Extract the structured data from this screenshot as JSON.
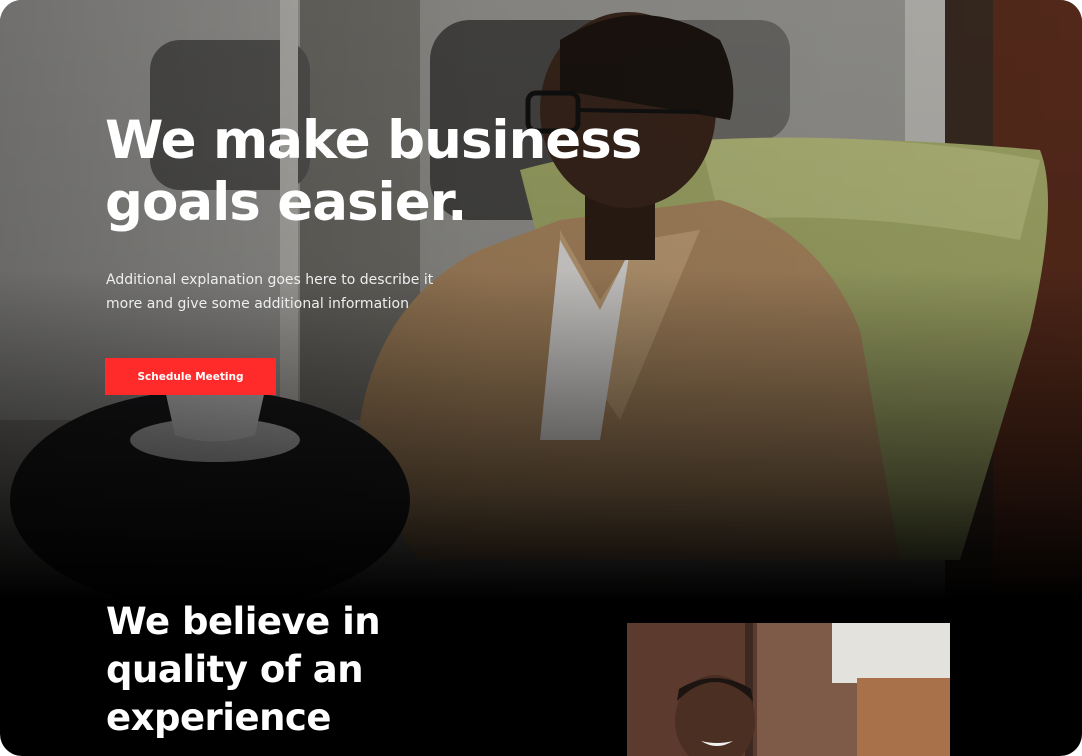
{
  "hero": {
    "title_line1": "We make business",
    "title_line2": "goals easier.",
    "description_line1": "Additional explanation goes here to describe it",
    "description_line2": "more and give some additional information",
    "cta_label": "Schedule Meeting",
    "cta_color": "#ff2a2a"
  },
  "section2": {
    "title_line1": "We believe in",
    "title_line2": "quality of an",
    "title_line3": "experience"
  }
}
